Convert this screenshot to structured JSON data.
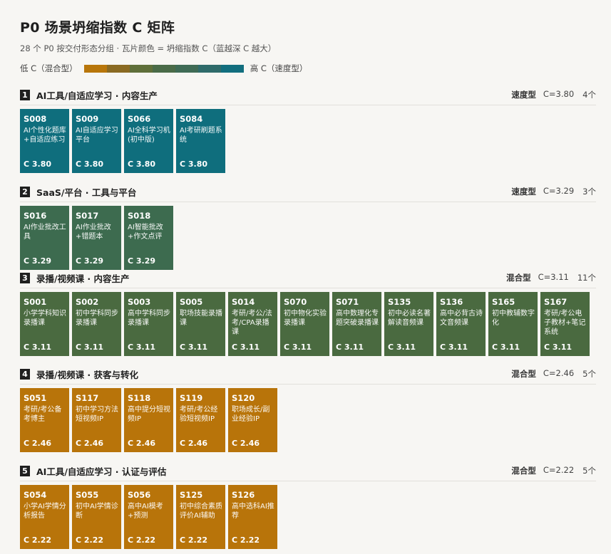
{
  "title": "P0 场景坍缩指数 C 矩阵",
  "subtitle": "28 个 P0 按交付形态分组 · 瓦片颜色 = 坍缩指数 C（蓝越深 C 越大）",
  "legend": {
    "low_label": "低 C（混合型）",
    "high_label": "高 C（速度型）",
    "colors": [
      "#b8760a",
      "#8a6a22",
      "#5f6f3a",
      "#4a6b48",
      "#3f6b55",
      "#2f6b6a",
      "#126e7e"
    ]
  },
  "colors": {
    "speed_teal": "#0f6e7d",
    "speed_green": "#3d6b4f",
    "mixed_green": "#4a6a40",
    "mixed_orange": "#b8740a"
  },
  "chart_data": {
    "type": "heatmap",
    "metric": "C",
    "groups": [
      {
        "num": "1",
        "title": "AI工具/自适应学习 · 内容生产",
        "type_label": "速度型",
        "c_label": "C=3.80",
        "count_label": "4个",
        "color": "#0f6e7d",
        "tiles": [
          {
            "id": "S008",
            "name": "AI个性化题库+自适应练习",
            "c": 3.8,
            "c_label": "C 3.80"
          },
          {
            "id": "S009",
            "name": "AI自适应学习平台",
            "c": 3.8,
            "c_label": "C 3.80"
          },
          {
            "id": "S066",
            "name": "AI全科学习机(初中版)",
            "c": 3.8,
            "c_label": "C 3.80"
          },
          {
            "id": "S084",
            "name": "AI考研刷题系统",
            "c": 3.8,
            "c_label": "C 3.80"
          }
        ]
      },
      {
        "num": "2",
        "title": "SaaS/平台 · 工具与平台",
        "type_label": "速度型",
        "c_label": "C=3.29",
        "count_label": "3个",
        "color": "#3d6b4f",
        "tiles": [
          {
            "id": "S016",
            "name": "AI作业批改工具",
            "c": 3.29,
            "c_label": "C 3.29"
          },
          {
            "id": "S017",
            "name": "AI作业批改+错题本",
            "c": 3.29,
            "c_label": "C 3.29"
          },
          {
            "id": "S018",
            "name": "AI智能批改+作文点评",
            "c": 3.29,
            "c_label": "C 3.29"
          }
        ]
      },
      {
        "num": "3",
        "title": "录播/视频课 · 内容生产",
        "type_label": "混合型",
        "c_label": "C=3.11",
        "count_label": "11个",
        "color": "#4a6a40",
        "tiles": [
          {
            "id": "S001",
            "name": "小学学科知识录播课",
            "c": 3.11,
            "c_label": "C 3.11"
          },
          {
            "id": "S002",
            "name": "初中学科同步录播课",
            "c": 3.11,
            "c_label": "C 3.11"
          },
          {
            "id": "S003",
            "name": "高中学科同步录播课",
            "c": 3.11,
            "c_label": "C 3.11"
          },
          {
            "id": "S005",
            "name": "职场技能录播课",
            "c": 3.11,
            "c_label": "C 3.11"
          },
          {
            "id": "S014",
            "name": "考研/考公/法考/CPA录播课",
            "c": 3.11,
            "c_label": "C 3.11"
          },
          {
            "id": "S070",
            "name": "初中物化实验录播课",
            "c": 3.11,
            "c_label": "C 3.11"
          },
          {
            "id": "S071",
            "name": "高中数理化专题突破录播课",
            "c": 3.11,
            "c_label": "C 3.11"
          },
          {
            "id": "S135",
            "name": "初中必读名著解读音频课",
            "c": 3.11,
            "c_label": "C 3.11"
          },
          {
            "id": "S136",
            "name": "高中必背古诗文音频课",
            "c": 3.11,
            "c_label": "C 3.11"
          },
          {
            "id": "S165",
            "name": "初中教辅数字化",
            "c": 3.11,
            "c_label": "C 3.11"
          },
          {
            "id": "S167",
            "name": "考研/考公电子教材+笔记系统",
            "c": 3.11,
            "c_label": "C 3.11"
          }
        ]
      },
      {
        "num": "4",
        "title": "录播/视频课 · 获客与转化",
        "type_label": "混合型",
        "c_label": "C=2.46",
        "count_label": "5个",
        "color": "#b8740a",
        "tiles": [
          {
            "id": "S051",
            "name": "考研/考公备考博主",
            "c": 2.46,
            "c_label": "C 2.46"
          },
          {
            "id": "S117",
            "name": "初中学习方法短视频IP",
            "c": 2.46,
            "c_label": "C 2.46"
          },
          {
            "id": "S118",
            "name": "高中提分短视频IP",
            "c": 2.46,
            "c_label": "C 2.46"
          },
          {
            "id": "S119",
            "name": "考研/考公经验短视频IP",
            "c": 2.46,
            "c_label": "C 2.46"
          },
          {
            "id": "S120",
            "name": "职场成长/副业经验IP",
            "c": 2.46,
            "c_label": "C 2.46"
          }
        ]
      },
      {
        "num": "5",
        "title": "AI工具/自适应学习 · 认证与评估",
        "type_label": "混合型",
        "c_label": "C=2.22",
        "count_label": "5个",
        "color": "#b8740a",
        "tiles": [
          {
            "id": "S054",
            "name": "小学AI学情分析报告",
            "c": 2.22,
            "c_label": "C 2.22"
          },
          {
            "id": "S055",
            "name": "初中AI学情诊断",
            "c": 2.22,
            "c_label": "C 2.22"
          },
          {
            "id": "S056",
            "name": "高中AI模考+预测",
            "c": 2.22,
            "c_label": "C 2.22"
          },
          {
            "id": "S125",
            "name": "初中综合素质评价AI辅助",
            "c": 2.22,
            "c_label": "C 2.22"
          },
          {
            "id": "S126",
            "name": "高中选科AI推荐",
            "c": 2.22,
            "c_label": "C 2.22"
          }
        ]
      }
    ]
  }
}
